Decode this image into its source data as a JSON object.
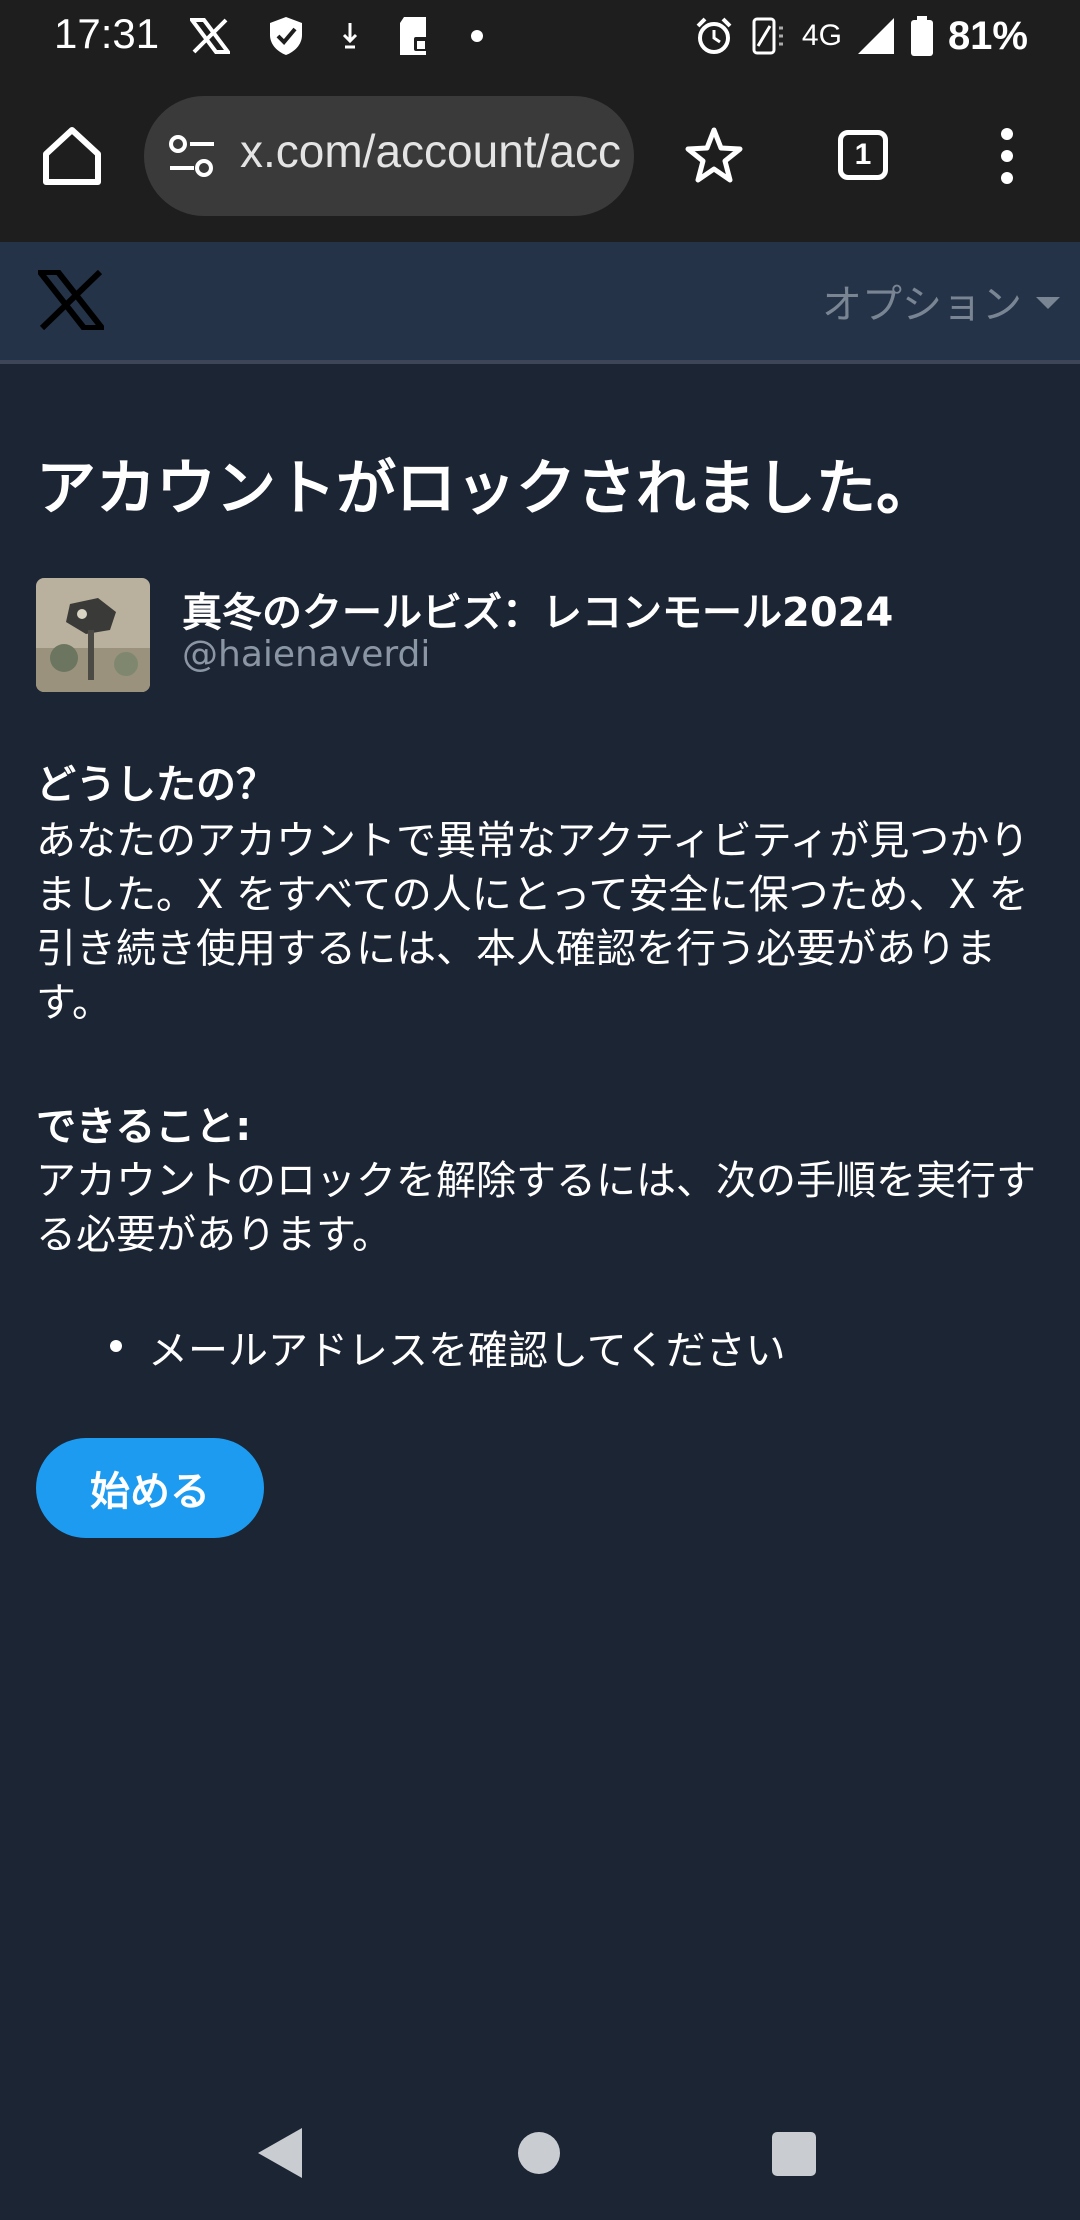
{
  "status_bar": {
    "time": "17:31",
    "network": "4G",
    "battery": "81%",
    "icons": [
      "x-notification-icon",
      "shield-icon",
      "download-icon",
      "sd-card-icon",
      "dot-icon",
      "alarm-icon",
      "vibrate-icon",
      "signal-icon",
      "battery-icon"
    ]
  },
  "browser": {
    "url": "x.com/account/access",
    "tab_count": "1",
    "icons": [
      "home-icon",
      "site-settings-icon",
      "star-icon",
      "tabs-icon",
      "more-icon"
    ]
  },
  "header": {
    "logo": "x-logo",
    "options_label": "オプション"
  },
  "main": {
    "title": "アカウントがロックされました。",
    "account": {
      "display_name": "真冬のクールビズ：レコンモール2024",
      "handle": "@haienaverdi"
    },
    "what_happened": {
      "heading": "どうしたの？",
      "body": "あなたのアカウントで異常なアクティビティが見つかりました。X をすべての人にとって安全に保つため、X を引き続き使用するには、本人確認を行う必要があります。"
    },
    "what_to_do": {
      "heading": "できること:",
      "body": "アカウントのロックを解除するには、次の手順を実行する必要があります。",
      "steps": [
        "メールアドレスを確認してください"
      ]
    },
    "start_button": "始める"
  },
  "colors": {
    "page_bg": "#1c2533",
    "header_bg": "#243348",
    "accent": "#1d9bf0",
    "muted_text": "#8b96a5"
  }
}
